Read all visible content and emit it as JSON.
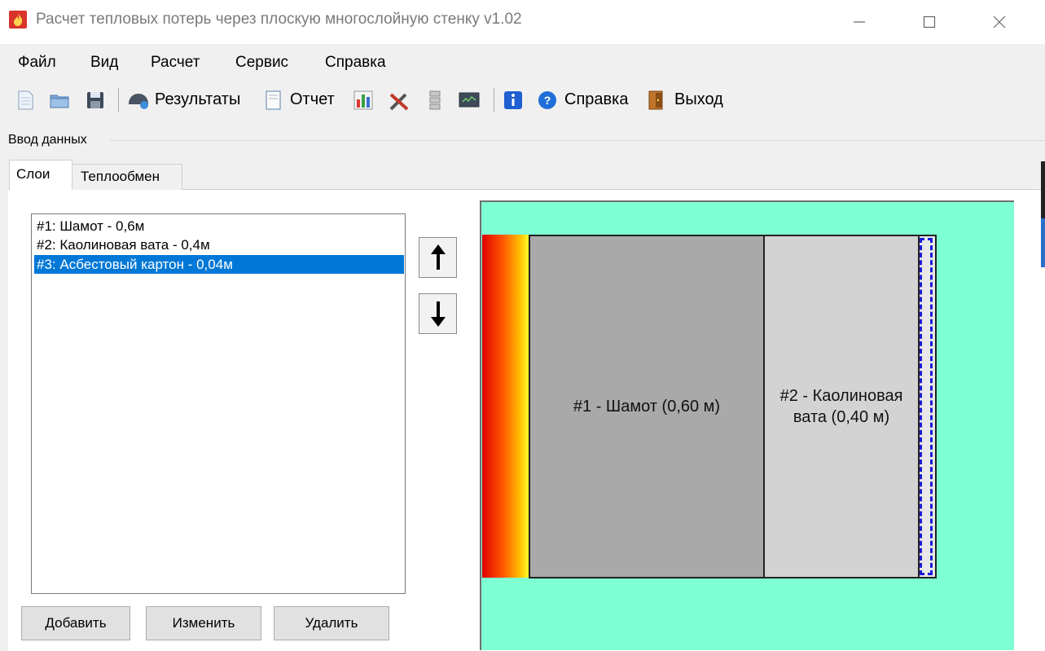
{
  "window": {
    "title": "Расчет тепловых потерь через плоскую многослойную стенку v1.02",
    "icon": "flame-icon",
    "controls": [
      "minimize-icon",
      "maximize-icon",
      "close-icon"
    ]
  },
  "menu": {
    "file": "Файл",
    "view": "Вид",
    "calc": "Расчет",
    "service": "Сервис",
    "help": "Справка"
  },
  "toolbar": {
    "results": "Результаты",
    "report": "Отчет",
    "help": "Справка",
    "exit": "Выход"
  },
  "group": {
    "label": "Ввод данных"
  },
  "tabs": {
    "layers": "Слои",
    "heat_exchange": "Теплообмен"
  },
  "layers_list": {
    "items": [
      "#1: Шамот - 0,6м",
      "#2: Каолиновая вата - 0,4м",
      "#3: Асбестовый картон - 0,04м"
    ],
    "selected_index": 2
  },
  "buttons": {
    "add": "Добавить",
    "edit": "Изменить",
    "delete": "Удалить"
  },
  "diagram": {
    "layer_1": "#1 - Шамот (0,60 м)",
    "layer_2": "#2 - Каолиновая вата (0,40 м)",
    "colors": {
      "background": "#7fffd4",
      "layer_1": "#a9a9a9",
      "layer_2": "#d3d3d3",
      "selection": "#1a1ad8"
    }
  },
  "colors": {
    "selection": "#0078d7",
    "app_icon": "#d9342b"
  }
}
